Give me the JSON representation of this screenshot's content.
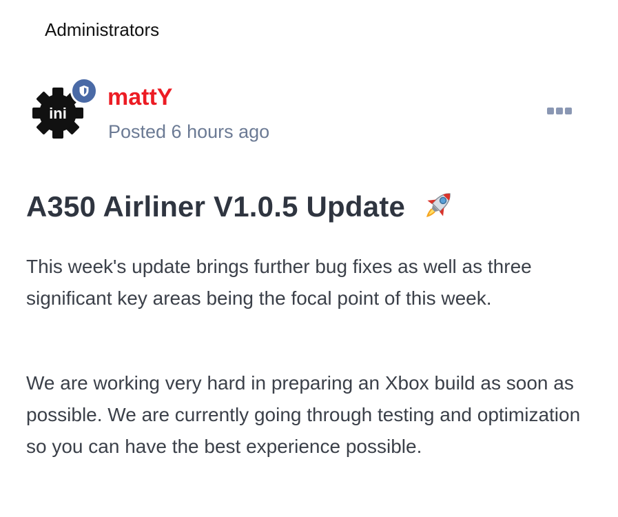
{
  "group": {
    "label": "Administrators"
  },
  "author": {
    "avatar_text": "ini",
    "badge_icon": "shield-icon",
    "username": "mattY",
    "username_color": "#ec1c24",
    "posted": "Posted 6 hours ago"
  },
  "menu": {
    "icon": "more-options-icon"
  },
  "post": {
    "title": "A350 Airliner V1.0.5 Update",
    "title_emoji_icon": "rocket-icon",
    "paragraphs": [
      "This week's update brings further bug fixes as well as three significant key areas being the focal point of this week.",
      "We are working very hard in preparing an Xbox build as soon as possible. We are currently going through testing and optimization so you can have the best experience possible."
    ]
  }
}
